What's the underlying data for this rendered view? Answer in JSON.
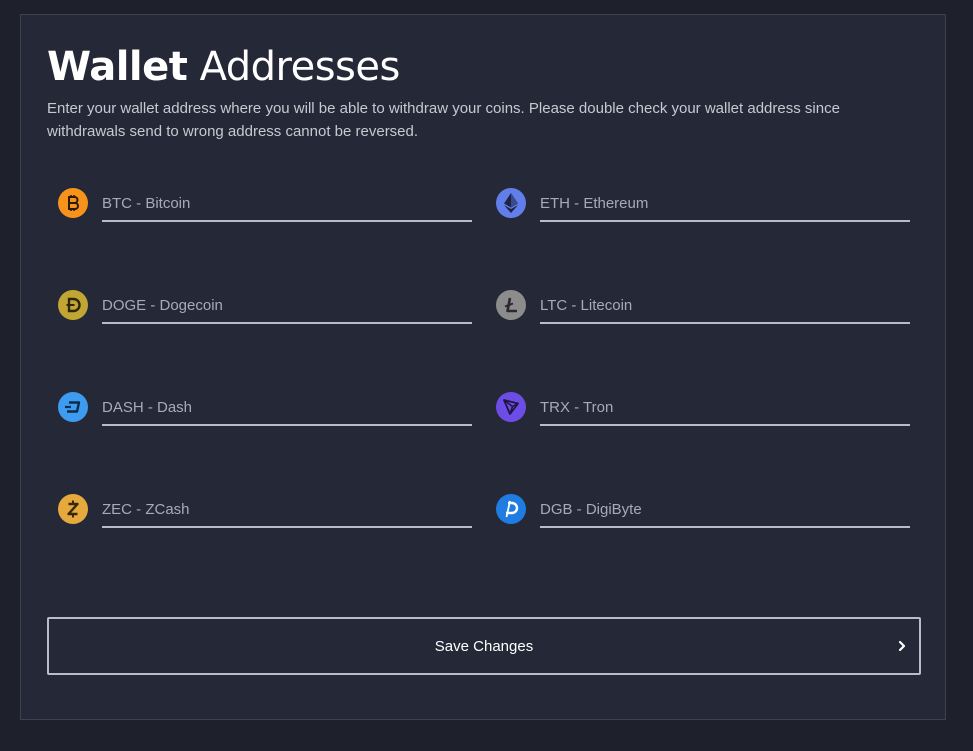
{
  "header": {
    "title_bold": "Wallet",
    "title_rest": " Addresses",
    "description": "Enter your wallet address where you will be able to withdraw your coins. Please double check your wallet address since withdrawals send to wrong address cannot be reversed."
  },
  "wallets": [
    {
      "code": "btc",
      "placeholder": "BTC - Bitcoin",
      "value": "",
      "icon": "bitcoin-icon",
      "color": "#f7931a"
    },
    {
      "code": "eth",
      "placeholder": "ETH - Ethereum",
      "value": "",
      "icon": "ethereum-icon",
      "color": "#627eea"
    },
    {
      "code": "doge",
      "placeholder": "DOGE - Dogecoin",
      "value": "",
      "icon": "dogecoin-icon",
      "color": "#c2a633"
    },
    {
      "code": "ltc",
      "placeholder": "LTC - Litecoin",
      "value": "",
      "icon": "litecoin-icon",
      "color": "#8c8c8c"
    },
    {
      "code": "dash",
      "placeholder": "DASH - Dash",
      "value": "",
      "icon": "dash-icon",
      "color": "#3d9cf0"
    },
    {
      "code": "trx",
      "placeholder": "TRX - Tron",
      "value": "",
      "icon": "tron-icon",
      "color": "#6c4de6"
    },
    {
      "code": "zec",
      "placeholder": "ZEC - ZCash",
      "value": "",
      "icon": "zcash-icon",
      "color": "#e5a93d"
    },
    {
      "code": "dgb",
      "placeholder": "DGB - DigiByte",
      "value": "",
      "icon": "digibyte-icon",
      "color": "#1f7ce0"
    }
  ],
  "actions": {
    "save_label": "Save Changes",
    "save_icon": "chevron-right-icon"
  }
}
